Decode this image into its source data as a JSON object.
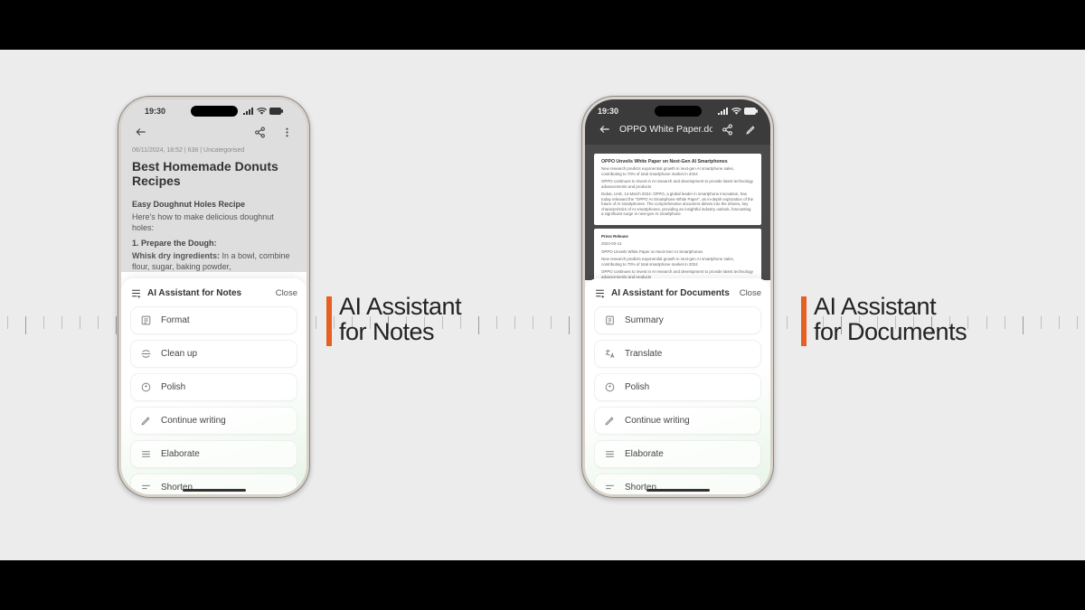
{
  "statusbar": {
    "time": "19:30"
  },
  "labels": {
    "notes_line1": "AI Assistant",
    "notes_line2": "for Notes",
    "docs_line1": "AI Assistant",
    "docs_line2": "for Documents"
  },
  "notes_screen": {
    "meta": "06/11/2024, 18:52  |  638  |  Uncategorised",
    "title": "Best Homemade Donuts Recipes",
    "subtitle": "Easy Doughnut Holes Recipe",
    "intro": "Here's how to make delicious doughnut holes:",
    "step_head": "1. Prepare the Dough:",
    "step_bold": "Whisk dry ingredients:",
    "step_rest": " In a bowl, combine flour, sugar, baking powder,"
  },
  "docs_screen": {
    "filename": "OPPO White Paper.docx",
    "doc_heading": "OPPO Unveils White Paper on Next-Gen AI Smartphones",
    "doc_p1": "New research predicts exponential growth in next-gen AI smartphone sales, contributing to 70% of total smartphone market in 2024",
    "doc_p2": "OPPO continues to invest in AI research and development to provide latest technology advancements and products",
    "doc_p3": "Dubai, UAE, 14 March 2024: OPPO, a global leader in smartphone innovation, has today released the \"OPPO AI Smartphone White Paper\", an in-depth exploration of the future of AI smartphones. The comprehensive document delves into the drivers, key characteristics of AI smartphones, providing an insightful industry outlook, forecasting a significant surge in next-gen AI smartphone",
    "doc_press": "Press Release",
    "doc_date": "2024-03-14"
  },
  "sheet_notes": {
    "title": "AI Assistant for Notes",
    "close": "Close",
    "options": [
      "Format",
      "Clean up",
      "Polish",
      "Continue writing",
      "Elaborate",
      "Shorten"
    ]
  },
  "sheet_docs": {
    "title": "AI Assistant for Documents",
    "close": "Close",
    "options": [
      "Summary",
      "Translate",
      "Polish",
      "Continue writing",
      "Elaborate",
      "Shorten"
    ]
  }
}
